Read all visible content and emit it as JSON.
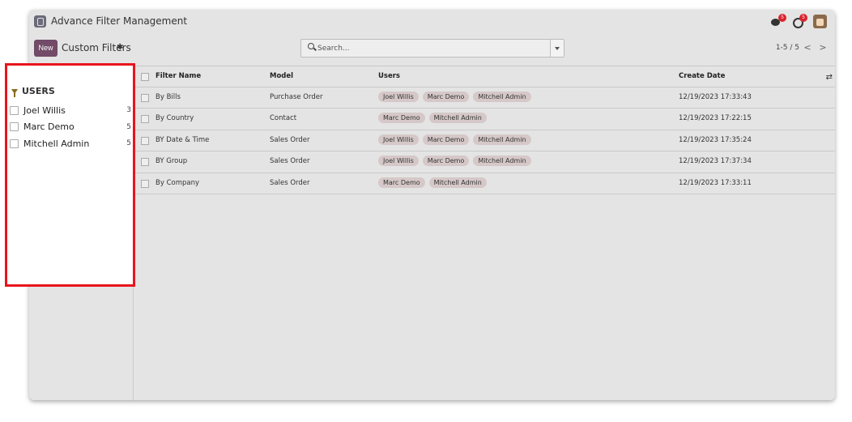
{
  "app": {
    "title": "Advance Filter Management"
  },
  "system": {
    "chat_badge": "5",
    "activity_badge": "5"
  },
  "control": {
    "new_label": "New",
    "page_title": "Custom Filters",
    "search_placeholder": "Search...",
    "pager": "1-5 / 5",
    "prev_label": "<",
    "next_label": ">"
  },
  "sidebar": {
    "title": "USERS",
    "facets": [
      {
        "label": "Joel Willis",
        "count": "3"
      },
      {
        "label": "Marc Demo",
        "count": "5"
      },
      {
        "label": "Mitchell Admin",
        "count": "5"
      }
    ]
  },
  "table": {
    "headers": {
      "name": "Filter Name",
      "model": "Model",
      "users": "Users",
      "date": "Create Date"
    },
    "rows": [
      {
        "name": "By Bills",
        "model": "Purchase Order",
        "users": [
          "Joel Willis",
          "Marc Demo",
          "Mitchell Admin"
        ],
        "date": "12/19/2023 17:33:43"
      },
      {
        "name": "By Country",
        "model": "Contact",
        "users": [
          "Marc Demo",
          "Mitchell Admin"
        ],
        "date": "12/19/2023 17:22:15"
      },
      {
        "name": "BY Date & Time",
        "model": "Sales Order",
        "users": [
          "Joel Willis",
          "Marc Demo",
          "Mitchell Admin"
        ],
        "date": "12/19/2023 17:35:24"
      },
      {
        "name": "BY Group",
        "model": "Sales Order",
        "users": [
          "Joel Willis",
          "Marc Demo",
          "Mitchell Admin"
        ],
        "date": "12/19/2023 17:37:34"
      },
      {
        "name": "By Company",
        "model": "Sales Order",
        "users": [
          "Marc Demo",
          "Mitchell Admin"
        ],
        "date": "12/19/2023 17:33:11"
      }
    ]
  },
  "colors": {
    "highlight": "#e8141c",
    "brand": "#714b67",
    "filter_icon": "#8a6b1c"
  }
}
